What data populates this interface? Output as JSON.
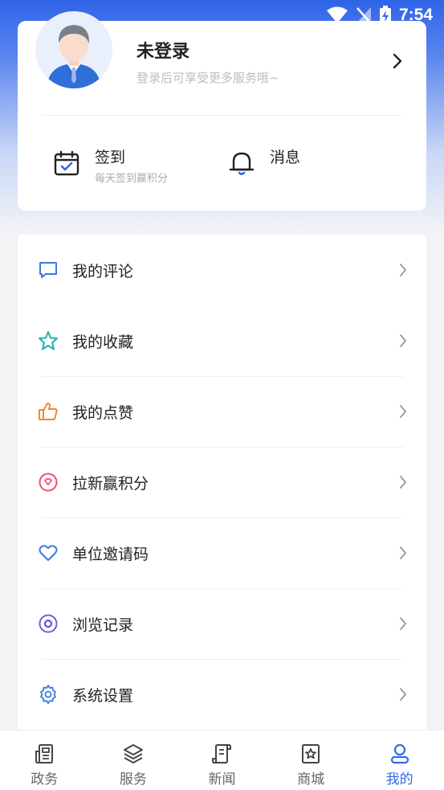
{
  "status_bar": {
    "time": "7:54",
    "icons": [
      "wifi-icon",
      "signal-off-icon",
      "battery-charging-icon"
    ]
  },
  "profile": {
    "name": "未登录",
    "hint": "登录后可享受更多服务哦~",
    "avatar_icon": "user-avatar"
  },
  "quick_actions": [
    {
      "icon": "calendar-check-icon",
      "title": "签到",
      "subtitle": "每天签到赢积分"
    },
    {
      "icon": "bell-icon",
      "title": "消息"
    }
  ],
  "menu": [
    {
      "icon": "comment-icon",
      "label": "我的评论",
      "color": "#3b78e7"
    },
    {
      "icon": "star-icon",
      "label": "我的收藏",
      "color": "#1fb3b3"
    },
    {
      "icon": "thumbs-up-icon",
      "label": "我的点赞",
      "color": "#f08a2c"
    },
    {
      "icon": "gem-icon",
      "label": "拉新赢积分",
      "color": "#f0506e"
    },
    {
      "icon": "heart-icon",
      "label": "单位邀请码",
      "color": "#3b78e7"
    },
    {
      "icon": "eye-icon",
      "label": "浏览记录",
      "color": "#6a5fd8"
    },
    {
      "icon": "gear-icon",
      "label": "系统设置",
      "color": "#3b78e7"
    }
  ],
  "bottom_nav": [
    {
      "icon": "newspaper-icon",
      "label": "政务",
      "active": false
    },
    {
      "icon": "layers-icon",
      "label": "服务",
      "active": false
    },
    {
      "icon": "scroll-icon",
      "label": "新闻",
      "active": false
    },
    {
      "icon": "shop-star-icon",
      "label": "商城",
      "active": false
    },
    {
      "icon": "person-icon",
      "label": "我的",
      "active": true
    }
  ],
  "colors": {
    "accent": "#2f6be8",
    "header_gradient": "#2f63e8"
  }
}
